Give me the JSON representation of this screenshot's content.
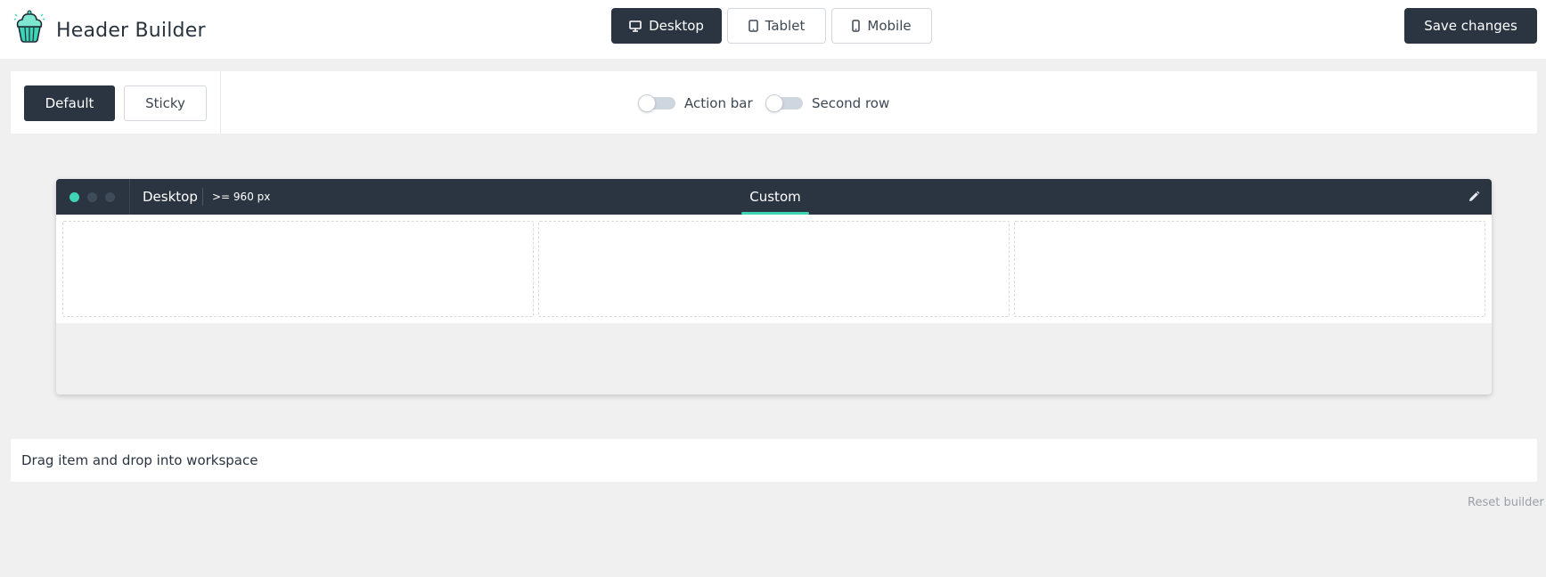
{
  "app": {
    "title": "Header Builder"
  },
  "device_tabs": [
    {
      "label": "Desktop",
      "icon": "monitor-icon",
      "active": true
    },
    {
      "label": "Tablet",
      "icon": "tablet-icon",
      "active": false
    },
    {
      "label": "Mobile",
      "icon": "mobile-icon",
      "active": false
    }
  ],
  "save_label": "Save changes",
  "modes": [
    {
      "label": "Default",
      "active": true
    },
    {
      "label": "Sticky",
      "active": false
    }
  ],
  "toggles": [
    {
      "label": "Action bar",
      "on": false
    },
    {
      "label": "Second row",
      "on": false
    }
  ],
  "preview": {
    "device": "Desktop",
    "width_rule": ">= 960 px",
    "tab": "Custom",
    "window_dots": [
      "#3fd4b6",
      "#404b59",
      "#404b59"
    ]
  },
  "drag_hint": "Drag item and drop into workspace",
  "reset_label": "Reset builder",
  "colors": {
    "accent": "#3fd4b6",
    "dark": "#2b3542",
    "background": "#f0f0f0"
  }
}
